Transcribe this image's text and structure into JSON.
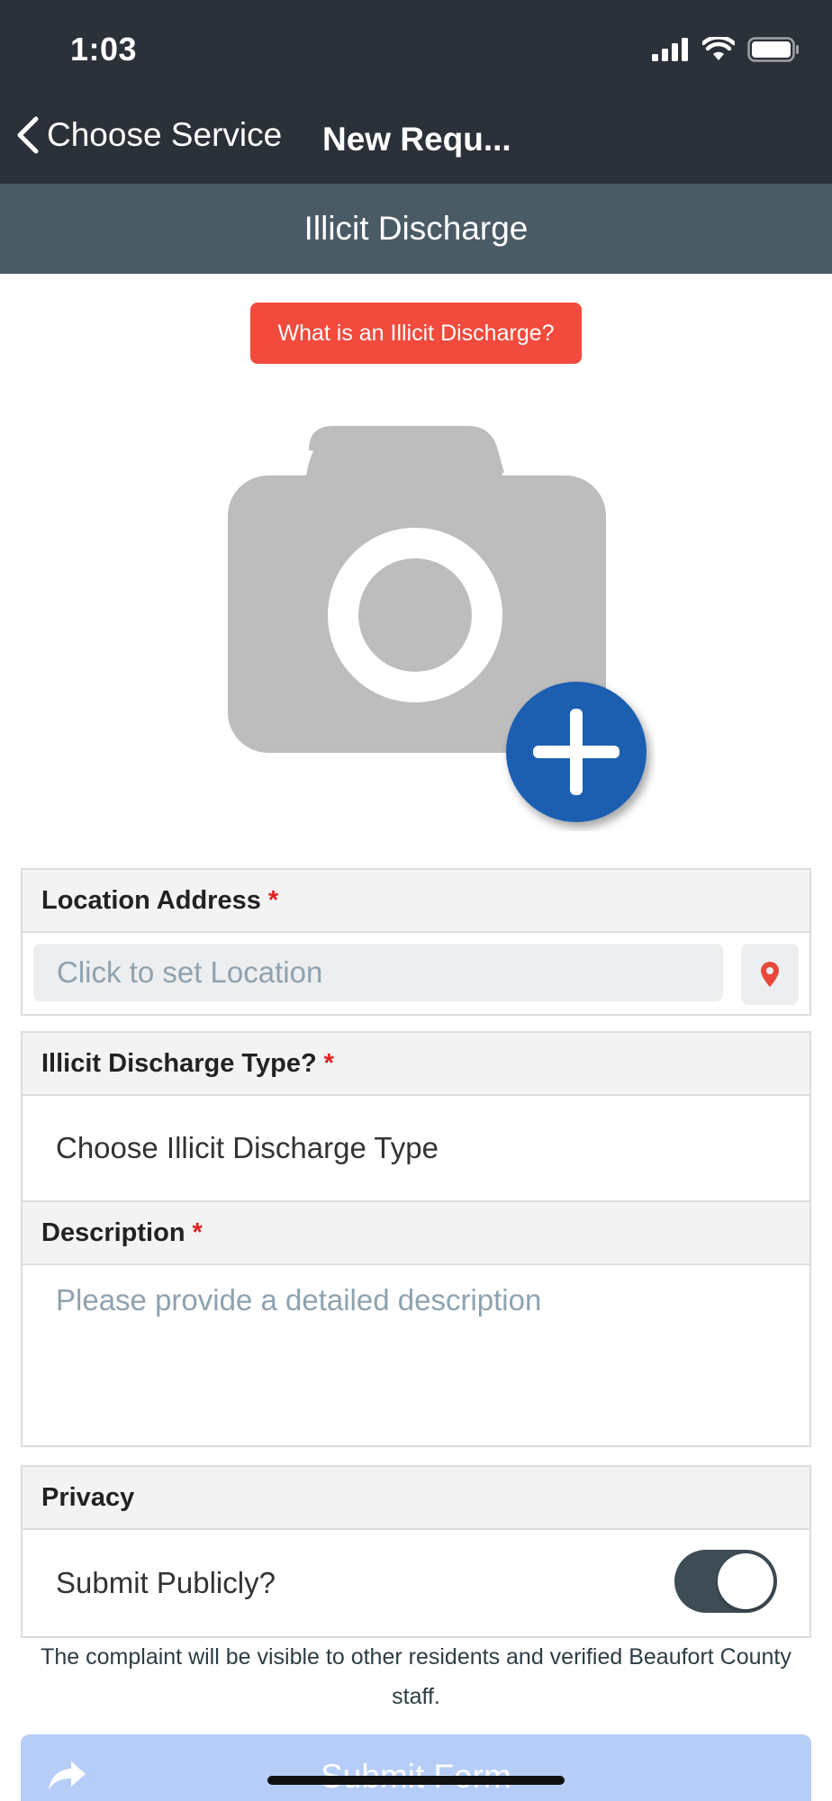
{
  "status_bar": {
    "time": "1:03"
  },
  "nav": {
    "back_label": "Choose Service",
    "title": "New Requ..."
  },
  "subheader": {
    "title": "Illicit Discharge"
  },
  "info_button": {
    "label": "What is an Illicit Discharge?"
  },
  "location": {
    "label": "Location Address",
    "required": "*",
    "placeholder": "Click to set Location"
  },
  "discharge_type": {
    "label": "Illicit Discharge Type?",
    "required": "*",
    "value": "Choose Illicit Discharge Type"
  },
  "description": {
    "label": "Description",
    "required": "*",
    "placeholder": "Please provide a detailed description"
  },
  "privacy": {
    "label": "Privacy",
    "toggle_label": "Submit Publicly?",
    "toggle_on": true
  },
  "privacy_note": "The complaint will be visible to other residents and verified Beaufort County staff.",
  "submit": {
    "label": "Submit Form"
  },
  "colors": {
    "nav_bg": "#2b3138",
    "subheader_bg": "#4a5b66",
    "info_button": "#f24a3c",
    "add_button": "#1b5fb0",
    "submit_bg": "#b6cef7"
  }
}
